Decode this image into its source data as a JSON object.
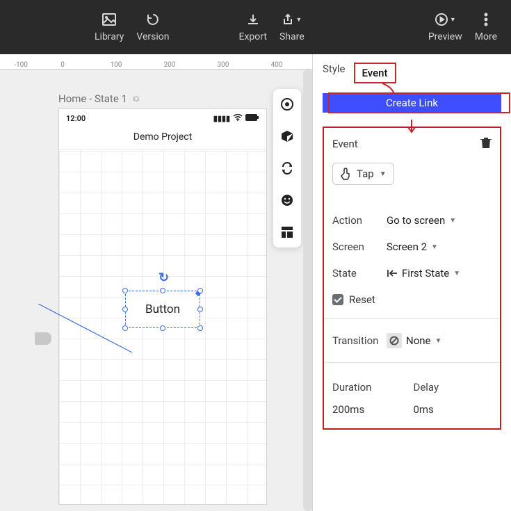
{
  "toolbar": {
    "library": "Library",
    "version": "Version",
    "export": "Export",
    "share": "Share",
    "preview": "Preview",
    "more": "More"
  },
  "ruler": {
    "ticks": [
      "-100",
      "0",
      "100",
      "200",
      "300",
      "400"
    ]
  },
  "page": {
    "title": "Home - State 1"
  },
  "device": {
    "time": "12:00",
    "app_title": "Demo Project",
    "button_text": "Button"
  },
  "inspector": {
    "tabs": {
      "style": "Style",
      "event": "Event"
    },
    "create_link": "Create Link",
    "event_header": "Event",
    "trigger": "Tap",
    "action_label": "Action",
    "action_value": "Go to screen",
    "screen_label": "Screen",
    "screen_value": "Screen 2",
    "state_label": "State",
    "state_value": "First State",
    "reset": "Reset",
    "transition_label": "Transition",
    "transition_value": "None",
    "duration_label": "Duration",
    "duration_value": "200ms",
    "delay_label": "Delay",
    "delay_value": "0ms"
  }
}
